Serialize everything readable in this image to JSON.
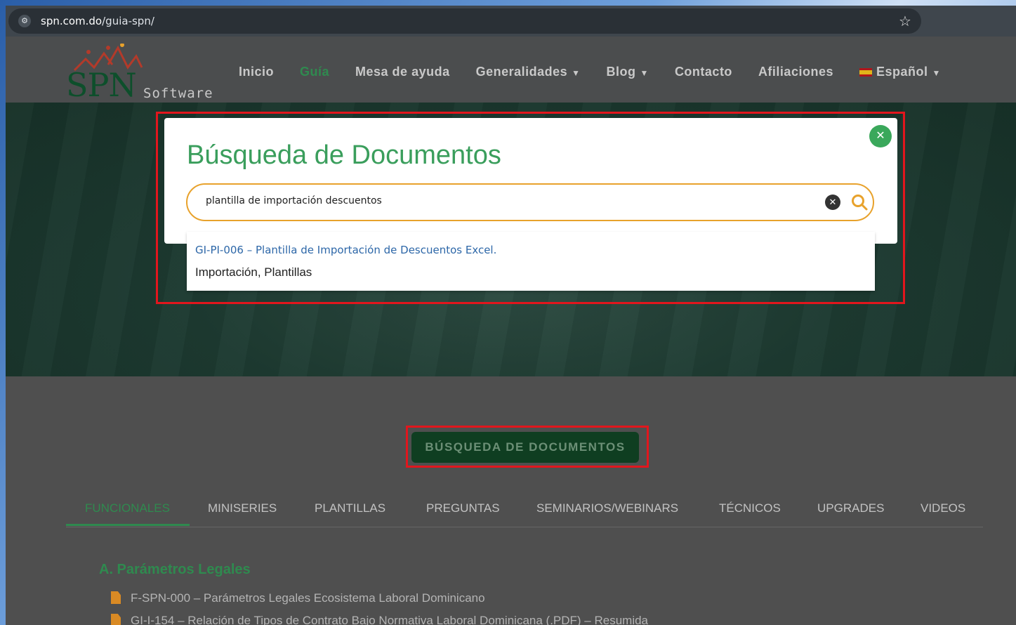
{
  "browser": {
    "url_host": "spn.com.do",
    "url_path": "/guia-spn/"
  },
  "nav": {
    "logo_text": "SPN",
    "logo_sub": "Software",
    "items": [
      {
        "label": "Inicio",
        "active": false,
        "dropdown": false
      },
      {
        "label": "Guía",
        "active": true,
        "dropdown": false
      },
      {
        "label": "Mesa de ayuda",
        "active": false,
        "dropdown": false
      },
      {
        "label": "Generalidades",
        "active": false,
        "dropdown": true
      },
      {
        "label": "Blog",
        "active": false,
        "dropdown": true
      },
      {
        "label": "Contacto",
        "active": false,
        "dropdown": false
      },
      {
        "label": "Afiliaciones",
        "active": false,
        "dropdown": false
      }
    ],
    "language": "Español"
  },
  "modal": {
    "title": "Búsqueda de Documentos",
    "search_value": "plantilla de importación descuentos",
    "suggestion": {
      "title": "GI-PI-006 – Plantilla de Importación de Descuentos Excel.",
      "tags": "Importación, Plantillas"
    }
  },
  "main_button": "BÚSQUEDA DE DOCUMENTOS",
  "tabs": [
    "FUNCIONALES",
    "MINISERIES",
    "PLANTILLAS",
    "PREGUNTAS",
    "SEMINARIOS/WEBINARS",
    "TÉCNICOS",
    "UPGRADES",
    "VIDEOS"
  ],
  "active_tab": "FUNCIONALES",
  "section": {
    "title": "A. Parámetros Legales",
    "docs": [
      "F-SPN-000 – Parámetros Legales Ecosistema Laboral Dominicano",
      "GI-I-154 – Relación de Tipos de Contrato Bajo Normativa Laboral Dominicana (.PDF) – Resumida"
    ]
  },
  "colors": {
    "brand_green": "#2f8a4f",
    "accent_orange": "#e8a22c",
    "highlight_red": "#e2161d",
    "link_blue": "#2d67a8"
  }
}
